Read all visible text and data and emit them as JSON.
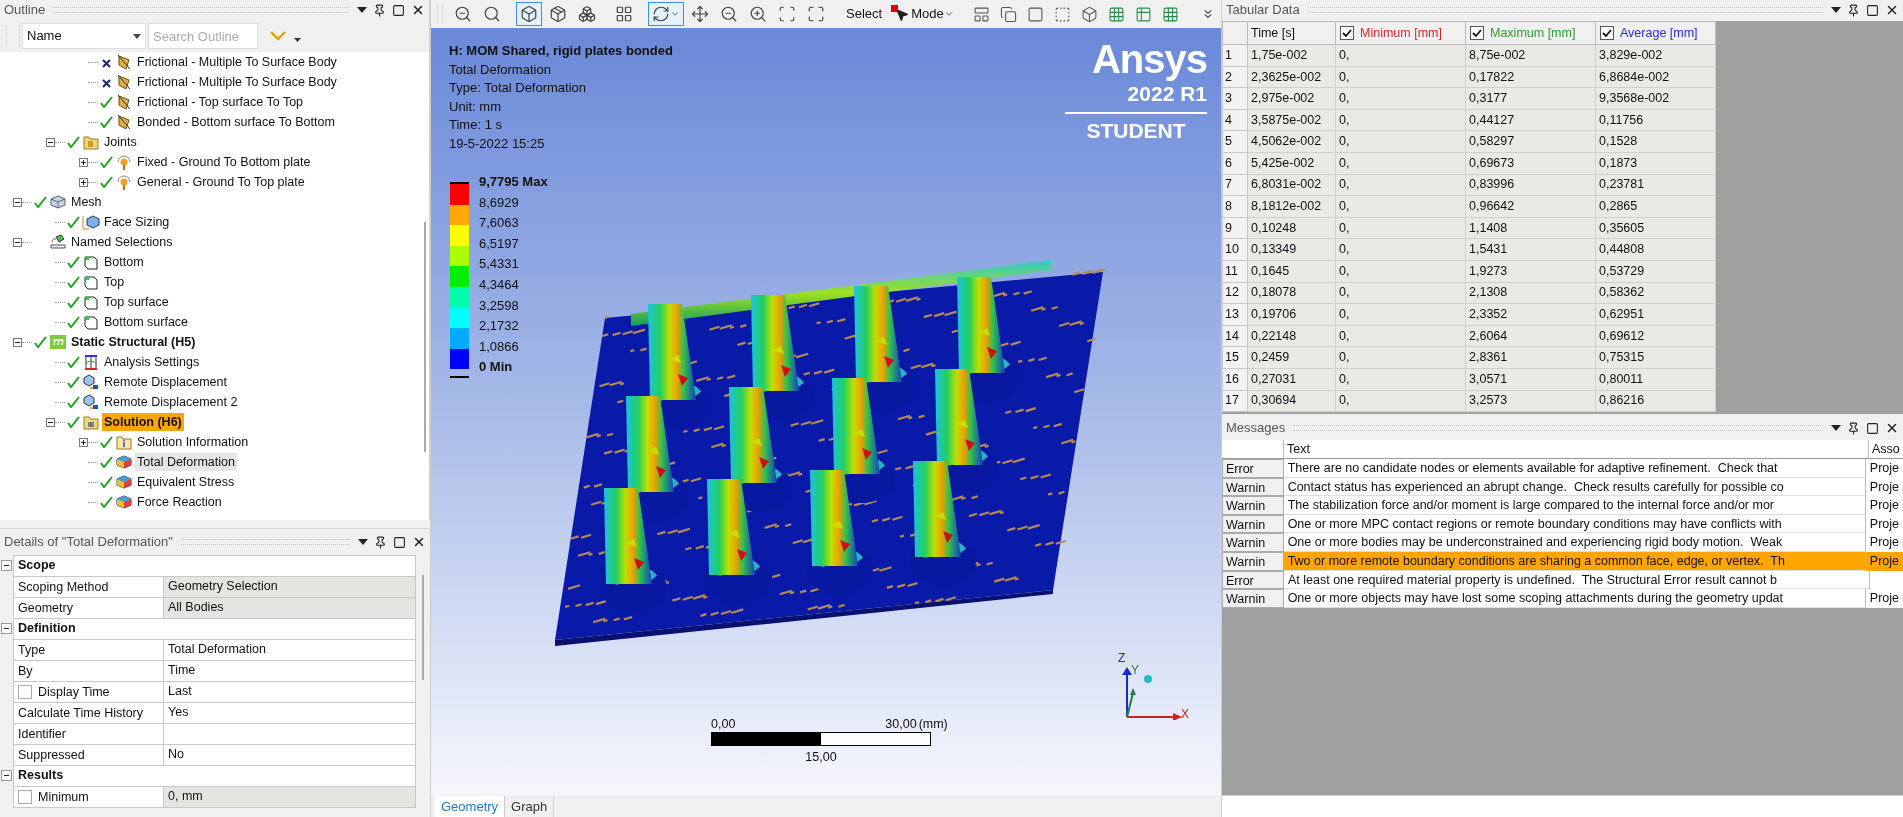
{
  "outline": {
    "title": "Outline",
    "filter": {
      "value": "Name"
    },
    "search": {
      "placeholder": "Search Outline"
    },
    "tree": [
      {
        "children": [
          {
            "children": [
              {
                "children": [
                  {
                    "label": "Frictional - Multiple To Surface Body",
                    "kind": "contact",
                    "valid": false,
                    "selected": false,
                    "hovered": false
                  },
                  {
                    "label": "Frictional - Multiple To Surface Body",
                    "kind": "contact",
                    "valid": false,
                    "selected": false,
                    "hovered": false
                  },
                  {
                    "label": "Frictional - Top surface To Top",
                    "kind": "contact",
                    "valid": true,
                    "selected": false,
                    "hovered": false
                  },
                  {
                    "label": "Bonded - Bottom surface To Bottom",
                    "kind": "contact",
                    "valid": true,
                    "selected": false,
                    "hovered": false
                  }
                ]
              },
              {
                "label": "Joints",
                "kind": "folder",
                "valid": true,
                "expanded": true,
                "selected": false,
                "hovered": false,
                "children": [
                  {
                    "label": "Fixed - Ground To Bottom plate",
                    "kind": "joint",
                    "valid": true,
                    "expanded": false,
                    "selected": false,
                    "hovered": false
                  },
                  {
                    "label": "General - Ground To Top plate",
                    "kind": "joint",
                    "valid": true,
                    "expanded": false,
                    "selected": false,
                    "hovered": false
                  }
                ]
              }
            ]
          },
          {
            "label": "Mesh",
            "kind": "mesh",
            "valid": true,
            "expanded": true,
            "selected": false,
            "hovered": false,
            "children": [
              {
                "label": "Face Sizing",
                "kind": "sizing",
                "valid": true,
                "selected": false,
                "hovered": false
              }
            ]
          },
          {
            "label": "Named Selections",
            "kind": "named",
            "expanded": true,
            "selected": false,
            "hovered": false,
            "children": [
              {
                "label": "Bottom",
                "kind": "selection",
                "valid": true,
                "selected": false,
                "hovered": false
              },
              {
                "label": "Top",
                "kind": "selection",
                "valid": true,
                "selected": false,
                "hovered": false
              },
              {
                "label": "Top surface",
                "kind": "selection",
                "valid": true,
                "selected": false,
                "hovered": false
              },
              {
                "label": "Bottom surface",
                "kind": "selection",
                "valid": true,
                "selected": false,
                "hovered": false
              }
            ]
          },
          {
            "label": "Static Structural (H5)",
            "kind": "analysis",
            "valid": true,
            "expanded": true,
            "selected": false,
            "hovered": false,
            "children": [
              {
                "label": "Analysis Settings",
                "kind": "settings",
                "valid": true,
                "selected": false,
                "hovered": false
              },
              {
                "label": "Remote Displacement",
                "kind": "displacement",
                "valid": true,
                "selected": false,
                "hovered": false
              },
              {
                "label": "Remote Displacement 2",
                "kind": "displacement",
                "valid": true,
                "selected": false,
                "hovered": false
              },
              {
                "label": "Solution (H6)",
                "kind": "solution",
                "valid": true,
                "expanded": true,
                "selected": true,
                "hovered": false,
                "children": [
                  {
                    "label": "Solution Information",
                    "kind": "info",
                    "valid": true,
                    "expanded": false,
                    "selected": false,
                    "hovered": false
                  },
                  {
                    "label": "Total Deformation",
                    "kind": "result",
                    "valid": true,
                    "selected": false,
                    "hovered": true
                  },
                  {
                    "label": "Equivalent Stress",
                    "kind": "result",
                    "valid": true,
                    "selected": false,
                    "hovered": false
                  },
                  {
                    "label": "Force Reaction",
                    "kind": "result",
                    "valid": true,
                    "selected": false,
                    "hovered": false
                  }
                ]
              }
            ]
          }
        ]
      }
    ]
  },
  "details": {
    "title": "Details of \"Total Deformation\"",
    "sections": [
      {
        "label": "Scope",
        "expanded": true,
        "rows": [
          {
            "label": "Scoping Method",
            "value": "Geometry Selection",
            "read_only": true
          },
          {
            "label": "Geometry",
            "value": "All Bodies",
            "read_only": true
          }
        ]
      },
      {
        "label": "Definition",
        "expanded": true,
        "rows": [
          {
            "label": "Type",
            "value": "Total Deformation",
            "read_only": false
          },
          {
            "label": "By",
            "value": "Time",
            "read_only": false
          },
          {
            "label": "Display Time",
            "value": "Last",
            "read_only": false,
            "checked": false
          },
          {
            "label": "Calculate Time History",
            "value": "Yes",
            "read_only": false
          },
          {
            "label": "Identifier",
            "read_only": false
          },
          {
            "label": "Suppressed",
            "value": "No",
            "read_only": false
          }
        ]
      },
      {
        "label": "Results",
        "expanded": true,
        "rows": [
          {
            "label": "Minimum",
            "value": "0, mm",
            "read_only": true,
            "checked": false
          }
        ]
      }
    ]
  },
  "toolbar": {
    "tools": [
      {
        "selected": false
      },
      {
        "selected": false
      },
      {
        "selected": true
      },
      {
        "selected": false
      },
      {
        "selected": false
      },
      {
        "selected": false
      },
      {
        "selected": true
      },
      {
        "selected": false
      },
      {
        "selected": false
      },
      {
        "selected": false
      },
      {
        "selected": false
      },
      {
        "selected": false
      }
    ],
    "select_label": "Select",
    "mode_label": "Mode"
  },
  "viewport": {
    "title": "H: MOM Shared, rigid plates bonded",
    "info": [
      "Total Deformation",
      "Type: Total Deformation",
      "Unit: mm",
      "Time: 1 s",
      "19-5-2022 15:25"
    ],
    "logo": {
      "name": "Ansys",
      "version": "2022 R1",
      "edition": "STUDENT"
    },
    "legend": {
      "labels": [
        "9,7795 Max",
        "8,6929",
        "7,6063",
        "6,5197",
        "5,4331",
        "4,3464",
        "3,2598",
        "2,1732",
        "1,0866",
        "0 Min"
      ],
      "bands": [
        {
          "color": "#ff0000"
        },
        {
          "color": "#ffaa00"
        },
        {
          "color": "#ffff00"
        },
        {
          "color": "#aaff00"
        },
        {
          "color": "#00ee00"
        },
        {
          "color": "#00ffaa"
        },
        {
          "color": "#00ffff"
        },
        {
          "color": "#00aaff"
        },
        {
          "color": "#0000ff"
        }
      ]
    },
    "scale": {
      "start": "0,00",
      "end": "30,00",
      "unit": "(mm)",
      "middle": "15,00"
    },
    "axes": {
      "z": "Z",
      "y": "Y",
      "x": "X"
    },
    "tabs": [
      {
        "label": "Geometry",
        "selected": true
      },
      {
        "label": "Graph",
        "selected": false
      }
    ]
  },
  "tabular": {
    "title": "Tabular Data",
    "time_column": "Time [s]",
    "series_columns": [
      {
        "label": "Minimum [mm]",
        "checked": true,
        "color": "#d42a2a"
      },
      {
        "label": "Maximum [mm]",
        "checked": true,
        "color": "#2aa02a"
      },
      {
        "label": "Average [mm]",
        "checked": true,
        "color": "#2a2ad4"
      }
    ],
    "rows": [
      {
        "index": "1",
        "cells": [
          "1,75e-002",
          "0,",
          "8,75e-002",
          "3,829e-002"
        ]
      },
      {
        "index": "2",
        "cells": [
          "2,3625e-002",
          "0,",
          "0,17822",
          "6,8684e-002"
        ]
      },
      {
        "index": "3",
        "cells": [
          "2,975e-002",
          "0,",
          "0,3177",
          "9,3568e-002"
        ]
      },
      {
        "index": "4",
        "cells": [
          "3,5875e-002",
          "0,",
          "0,44127",
          "0,11756"
        ]
      },
      {
        "index": "5",
        "cells": [
          "4,5062e-002",
          "0,",
          "0,58297",
          "0,1528"
        ]
      },
      {
        "index": "6",
        "cells": [
          "5,425e-002",
          "0,",
          "0,69673",
          "0,1873"
        ]
      },
      {
        "index": "7",
        "cells": [
          "6,8031e-002",
          "0,",
          "0,83996",
          "0,23781"
        ]
      },
      {
        "index": "8",
        "cells": [
          "8,1812e-002",
          "0,",
          "0,96642",
          "0,2865"
        ]
      },
      {
        "index": "9",
        "cells": [
          "0,10248",
          "0,",
          "1,1408",
          "0,35605"
        ]
      },
      {
        "index": "10",
        "cells": [
          "0,13349",
          "0,",
          "1,5431",
          "0,44808"
        ]
      },
      {
        "index": "11",
        "cells": [
          "0,1645",
          "0,",
          "1,9273",
          "0,53729"
        ]
      },
      {
        "index": "12",
        "cells": [
          "0,18078",
          "0,",
          "2,1308",
          "0,58362"
        ]
      },
      {
        "index": "13",
        "cells": [
          "0,19706",
          "0,",
          "2,3352",
          "0,62951"
        ]
      },
      {
        "index": "14",
        "cells": [
          "0,22148",
          "0,",
          "2,6064",
          "0,69612"
        ]
      },
      {
        "index": "15",
        "cells": [
          "0,2459",
          "0,",
          "2,8361",
          "0,75315"
        ]
      },
      {
        "index": "16",
        "cells": [
          "0,27031",
          "0,",
          "3,0571",
          "0,80011"
        ]
      },
      {
        "index": "17",
        "cells": [
          "0,30694",
          "0,",
          "3,2573",
          "0,86216"
        ]
      }
    ]
  },
  "messages": {
    "title": "Messages",
    "columns": [
      "Text",
      "Asso"
    ],
    "rows": [
      {
        "level": "Error",
        "text": "There are no candidate nodes or elements available for adaptive refinement.  Check that",
        "association": "Proje",
        "selected": false
      },
      {
        "level": "Warnin",
        "text": "Contact status has experienced an abrupt change.  Check results carefully for possible co",
        "association": "Proje",
        "selected": false
      },
      {
        "level": "Warnin",
        "text": "The stabilization force and/or moment is large compared to the internal force and/or mor",
        "association": "Proje",
        "selected": false
      },
      {
        "level": "Warnin",
        "text": "One or more MPC contact regions or remote boundary conditions may have conflicts with",
        "association": "Proje",
        "selected": false
      },
      {
        "level": "Warnin",
        "text": "One or more bodies may be underconstrained and experiencing rigid body motion.  Weak",
        "association": "Proje",
        "selected": false
      },
      {
        "level": "Warnin",
        "text": "Two or more remote boundary conditions are sharing a common face, edge, or vertex.  Th",
        "association": "Proje",
        "selected": true
      },
      {
        "level": "Error",
        "text": "At least one required material property is undefined.  The Structural Error result cannot b",
        "selected": false
      },
      {
        "level": "Warnin",
        "text": "One or more objects may have lost some scoping attachments during the geometry updat",
        "association": "Proje",
        "selected": false
      }
    ]
  }
}
